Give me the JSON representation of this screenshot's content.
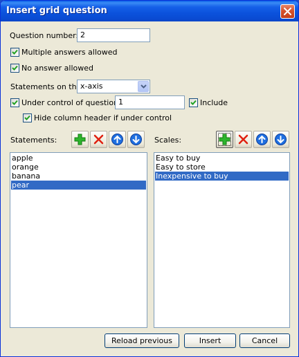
{
  "window": {
    "title": "Insert grid question"
  },
  "form": {
    "question_number_label": "Question number:",
    "question_number_value": "2",
    "multiple_answers_label": "Multiple answers allowed",
    "multiple_answers_checked": true,
    "no_answer_label": "No answer allowed",
    "no_answer_checked": true,
    "statements_on_label": "Statements on the",
    "statements_on_value": "x-axis",
    "under_control_label": "Under control of question:",
    "under_control_checked": true,
    "under_control_value": "1",
    "include_label": "Include",
    "include_checked": true,
    "hide_header_label": "Hide column header if under control",
    "hide_header_checked": true
  },
  "statements": {
    "label": "Statements:",
    "items": [
      "apple",
      "orange",
      "banana",
      "pear"
    ],
    "selected_index": 3
  },
  "scales": {
    "label": "Scales:",
    "items": [
      "Easy to buy",
      "Easy to store",
      "Inexpensive to buy"
    ],
    "selected_index": 2
  },
  "toolbar_icons": [
    "add-icon",
    "delete-icon",
    "move-up-icon",
    "move-down-icon"
  ],
  "buttons": {
    "reload_previous": "Reload previous",
    "insert": "Insert",
    "cancel": "Cancel"
  },
  "colors": {
    "title_bar": "#0a4bd3",
    "selection": "#316ac5",
    "dialog_bg": "#ece9d8",
    "close_button": "#d6522c",
    "add_icon": "#2db52d",
    "delete_icon": "#e02010",
    "arrow_icon": "#1f6fe0"
  }
}
